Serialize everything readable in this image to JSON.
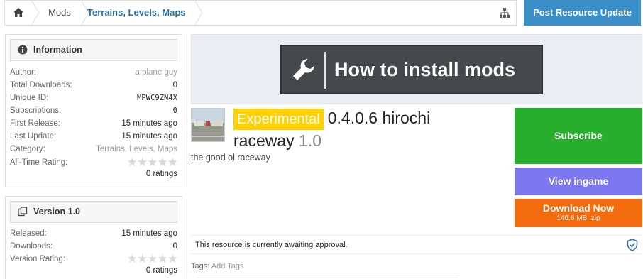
{
  "breadcrumb": {
    "home_icon": "home-icon",
    "items": [
      "Mods",
      "Terrains, Levels, Maps"
    ],
    "sitemap_icon": "sitemap-icon"
  },
  "header": {
    "post_update_label": "Post Resource Update"
  },
  "information": {
    "title": "Information",
    "icon": "info-circle-icon",
    "rows": {
      "author": {
        "label": "Author:",
        "value": "a plane guy"
      },
      "total_downloads": {
        "label": "Total Downloads:",
        "value": "0"
      },
      "unique_id": {
        "label": "Unique ID:",
        "value": "MPWC9ZN4X"
      },
      "subscriptions": {
        "label": "Subscriptions:",
        "value": "0"
      },
      "first_release": {
        "label": "First Release:",
        "value": "15 minutes ago"
      },
      "last_update": {
        "label": "Last Update:",
        "value": "15 minutes ago"
      },
      "category": {
        "label": "Category:",
        "value": "Terrains, Levels, Maps"
      },
      "all_time_rating": {
        "label": "All-Time Rating:",
        "stars": 0,
        "ratings_text": "0 ratings"
      }
    }
  },
  "version": {
    "title": "Version 1.0",
    "icon": "copy-icon",
    "rows": {
      "released": {
        "label": "Released:",
        "value": "15 minutes ago"
      },
      "downloads": {
        "label": "Downloads:",
        "value": "0"
      },
      "version_rating": {
        "label": "Version Rating:",
        "stars": 0,
        "ratings_text": "0 ratings"
      }
    }
  },
  "banner": {
    "text": "How to install mods",
    "icon": "wrench-icon"
  },
  "resource": {
    "badge": "Experimental",
    "title_part1": "0.4.0.6 hirochi",
    "title_part2": "raceway",
    "version": "1.0",
    "tagline": "the good ol raceway"
  },
  "actions": {
    "subscribe": "Subscribe",
    "view_ingame": "View ingame",
    "download": "Download Now",
    "download_size": "140.6 MB .zip"
  },
  "notice": {
    "text": "This resource is currently awaiting approval.",
    "icon": "shield-check-icon"
  },
  "tags": {
    "label": "Tags:",
    "add": "Add Tags"
  },
  "colors": {
    "accent_blue": "#3a8fc9",
    "subscribe_green": "#27ae2c",
    "view_purple": "#7b78ef",
    "download_orange": "#f26b0c",
    "badge_yellow": "#ffd100",
    "link_blue": "#2a6fa8"
  }
}
